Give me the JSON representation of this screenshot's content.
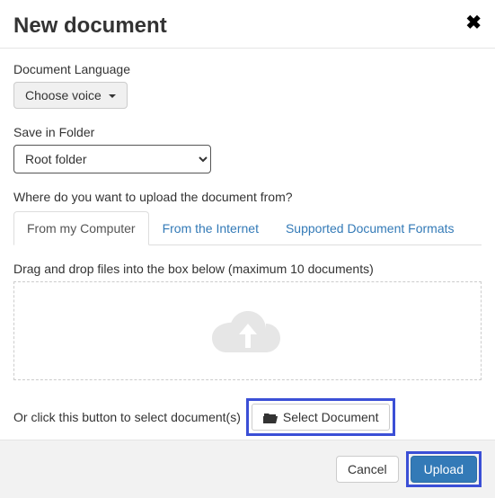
{
  "header": {
    "title": "New document",
    "close": "✖"
  },
  "language": {
    "label": "Document Language",
    "button": "Choose voice"
  },
  "folder": {
    "label": "Save in Folder",
    "selected": "Root folder"
  },
  "upload": {
    "prompt": "Where do you want to upload the document from?",
    "tabs": {
      "computer": "From my Computer",
      "internet": "From the Internet",
      "formats": "Supported Document Formats"
    },
    "drop_instruction": "Drag and drop files into the box below (maximum 10 documents)",
    "or_text": "Or click this button to select document(s)",
    "select_button": "Select Document"
  },
  "footer": {
    "cancel": "Cancel",
    "upload": "Upload"
  }
}
